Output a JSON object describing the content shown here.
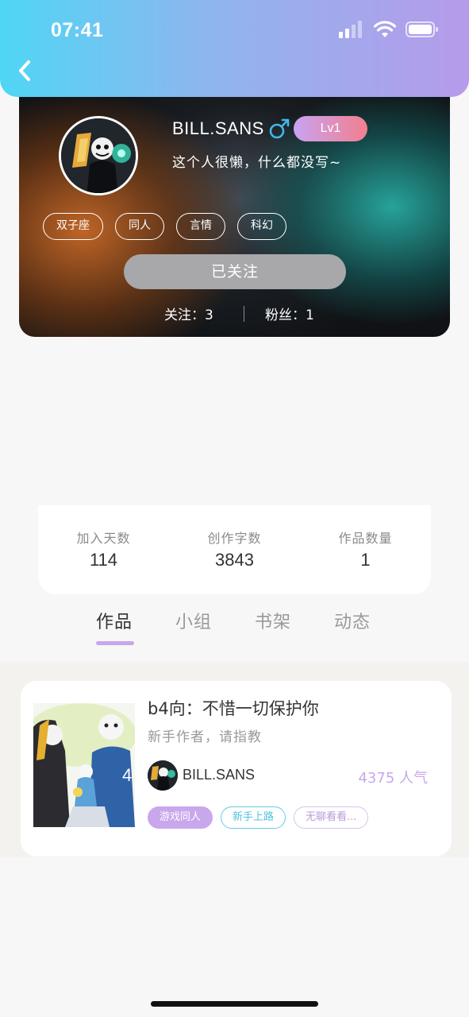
{
  "status_bar": {
    "time": "07:41"
  },
  "profile": {
    "name": "BILL.SANS",
    "gender_symbol": "♂",
    "level": "Lv1",
    "bio": "这个人很懒，什么都没写~",
    "tags": [
      "双子座",
      "同人",
      "言情",
      "科幻"
    ],
    "follow_button": "已关注",
    "following": "关注：3",
    "fans": "粉丝：1"
  },
  "stats": [
    {
      "label": "加入天数",
      "value": "114"
    },
    {
      "label": "创作字数",
      "value": "3843"
    },
    {
      "label": "作品数量",
      "value": "1"
    }
  ],
  "tabs": [
    "作品",
    "小组",
    "书架",
    "动态"
  ],
  "active_tab_index": 0,
  "works": [
    {
      "title": "b4向：不惜一切保护你",
      "subtitle": "新手作者，请指教",
      "author": "BILL.SANS",
      "popularity": "4375 人气",
      "tags": [
        "游戏同人",
        "新手上路",
        "无聊看看..."
      ]
    }
  ],
  "colors": {
    "header_gradient_start": "#4fd6f5",
    "header_gradient_end": "#b69bea",
    "accent_purple": "#c9a7ec",
    "accent_cyan": "#4fc3dc",
    "male_icon": "#3fb8e8"
  },
  "icons": {
    "back": "chevron-left-icon",
    "signal": "cellular-signal-icon",
    "wifi": "wifi-icon",
    "battery": "battery-icon",
    "gender": "male-icon"
  }
}
